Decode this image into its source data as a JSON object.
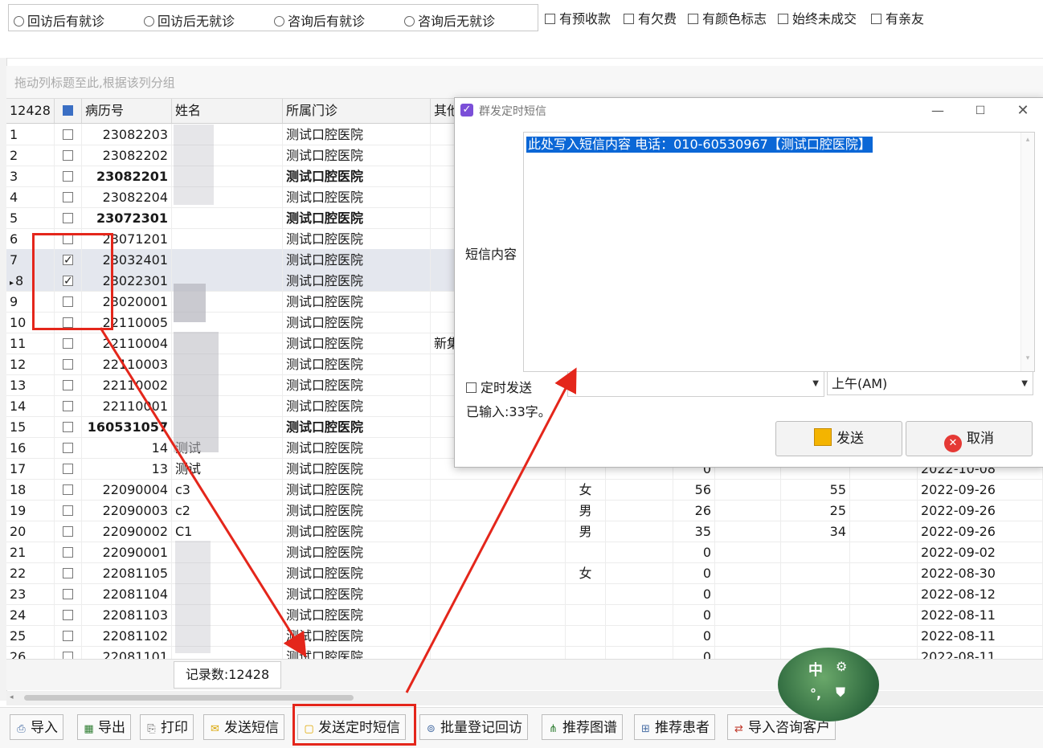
{
  "filters": {
    "radios": [
      "回访后有就诊",
      "回访后无就诊",
      "咨询后有就诊",
      "咨询后无就诊"
    ],
    "checkboxes": [
      "有预收款",
      "有欠费",
      "有颜色标志",
      "始终未成交",
      "有亲友"
    ]
  },
  "group_hint": "拖动列标题至此,根据该列分组",
  "grid": {
    "headers": {
      "rownum": "12428",
      "record_no": "病历号",
      "name": "姓名",
      "clinic": "所属门诊",
      "other": "其他"
    },
    "rows": [
      {
        "n": "1",
        "id": "23082203",
        "name": "",
        "clinic": "测试口腔医院",
        "bold": false,
        "checked": false
      },
      {
        "n": "2",
        "id": "23082202",
        "name": "",
        "clinic": "测试口腔医院",
        "bold": false,
        "checked": false
      },
      {
        "n": "3",
        "id": "23082201",
        "name": "",
        "clinic": "测试口腔医院",
        "bold": true,
        "checked": false
      },
      {
        "n": "4",
        "id": "23082204",
        "name": "",
        "clinic": "测试口腔医院",
        "bold": false,
        "checked": false
      },
      {
        "n": "5",
        "id": "23072301",
        "name": "",
        "clinic": "测试口腔医院",
        "bold": true,
        "checked": false
      },
      {
        "n": "6",
        "id": "23071201",
        "name": "",
        "clinic": "测试口腔医院",
        "bold": false,
        "checked": false
      },
      {
        "n": "7",
        "id": "23032401",
        "name": "",
        "clinic": "测试口腔医院",
        "bold": false,
        "checked": true
      },
      {
        "n": "8",
        "id": "23022301",
        "name": "",
        "clinic": "测试口腔医院",
        "bold": false,
        "checked": true
      },
      {
        "n": "9",
        "id": "23020001",
        "name": "",
        "clinic": "测试口腔医院",
        "bold": false,
        "checked": false
      },
      {
        "n": "10",
        "id": "22110005",
        "name": "",
        "clinic": "测试口腔医院",
        "bold": false,
        "checked": false
      },
      {
        "n": "11",
        "id": "22110004",
        "name": "",
        "clinic": "测试口腔医院",
        "bold": false,
        "checked": false,
        "other": "新集"
      },
      {
        "n": "12",
        "id": "22110003",
        "name": "",
        "clinic": "测试口腔医院",
        "bold": false,
        "checked": false
      },
      {
        "n": "13",
        "id": "22110002",
        "name": "",
        "clinic": "测试口腔医院",
        "bold": false,
        "checked": false
      },
      {
        "n": "14",
        "id": "22110001",
        "name": "",
        "clinic": "测试口腔医院",
        "bold": false,
        "checked": false
      },
      {
        "n": "15",
        "id": "160531057",
        "name": "",
        "clinic": "测试口腔医院",
        "bold": true,
        "checked": false
      },
      {
        "n": "16",
        "id": "14",
        "name": "测试",
        "clinic": "测试口腔医院",
        "bold": false,
        "checked": false
      },
      {
        "n": "17",
        "id": "13",
        "name": "测试",
        "clinic": "测试口腔医院",
        "bold": false,
        "checked": false,
        "v1": "0",
        "date": "2022-10-08"
      },
      {
        "n": "18",
        "id": "22090004",
        "name": "c3",
        "clinic": "测试口腔医院",
        "bold": false,
        "checked": false,
        "sex": "女",
        "v1": "56",
        "v2": "55",
        "date": "2022-09-26"
      },
      {
        "n": "19",
        "id": "22090003",
        "name": "c2",
        "clinic": "测试口腔医院",
        "bold": false,
        "checked": false,
        "sex": "男",
        "v1": "26",
        "v2": "25",
        "date": "2022-09-26"
      },
      {
        "n": "20",
        "id": "22090002",
        "name": "C1",
        "clinic": "测试口腔医院",
        "bold": false,
        "checked": false,
        "sex": "男",
        "v1": "35",
        "v2": "34",
        "date": "2022-09-26"
      },
      {
        "n": "21",
        "id": "22090001",
        "name": "",
        "clinic": "测试口腔医院",
        "bold": false,
        "checked": false,
        "v1": "0",
        "date": "2022-09-02"
      },
      {
        "n": "22",
        "id": "22081105",
        "name": "",
        "clinic": "测试口腔医院",
        "bold": false,
        "checked": false,
        "sex": "女",
        "v1": "0",
        "date": "2022-08-30"
      },
      {
        "n": "23",
        "id": "22081104",
        "name": "",
        "clinic": "测试口腔医院",
        "bold": false,
        "checked": false,
        "v1": "0",
        "date": "2022-08-12"
      },
      {
        "n": "24",
        "id": "22081103",
        "name": "",
        "clinic": "测试口腔医院",
        "bold": false,
        "checked": false,
        "v1": "0",
        "date": "2022-08-11"
      },
      {
        "n": "25",
        "id": "22081102",
        "name": "",
        "clinic": "测试口腔医院",
        "bold": false,
        "checked": false,
        "v1": "0",
        "date": "2022-08-11"
      },
      {
        "n": "26",
        "id": "22081101",
        "name": "",
        "clinic": "测试口腔医院",
        "bold": false,
        "checked": false,
        "v1": "0",
        "date": "2022-08-11"
      }
    ]
  },
  "record_count": "记录数:12428",
  "toolbar": {
    "buttons": [
      {
        "label": "导入",
        "icon": "import-icon"
      },
      {
        "label": "导出",
        "icon": "export-icon"
      },
      {
        "label": "打印",
        "icon": "print-icon"
      },
      {
        "label": "发送短信",
        "icon": "sms-icon"
      },
      {
        "label": "发送定时短信",
        "icon": "timed-sms-icon"
      },
      {
        "label": "批量登记回访",
        "icon": "batch-followup-icon"
      },
      {
        "label": "推荐图谱",
        "icon": "referral-graph-icon"
      },
      {
        "label": "推荐患者",
        "icon": "referral-patient-icon"
      },
      {
        "label": "导入咨询客户",
        "icon": "import-consult-icon"
      }
    ]
  },
  "dialog": {
    "title": "群发定时短信",
    "sms_label": "短信内容",
    "sms_text": "此处写入短信内容 电话：010-60530967【测试口腔医院】",
    "timed_send_label": "定时发送",
    "date_value": "",
    "ampm_value": "上午(AM)",
    "typed_count": "已输入:33字。",
    "send_label": "发送",
    "cancel_label": "取消"
  },
  "ime": {
    "mode": "中",
    "punct": "°,"
  },
  "colors": {
    "annotation_red": "#e4261b",
    "selection_blue": "#0b67d6",
    "dialog_check": "#7b4fd8"
  }
}
